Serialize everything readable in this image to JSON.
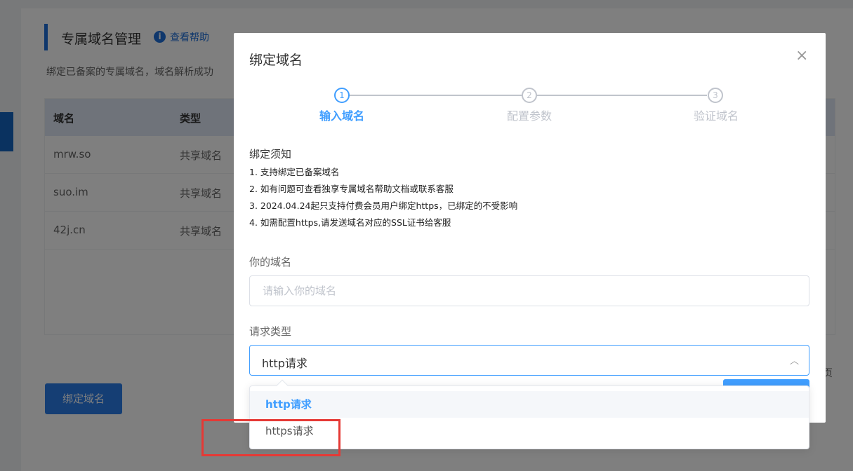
{
  "background": {
    "page_title": "专属域名管理",
    "help_link": "查看帮助",
    "description": "绑定已备案的专属域名，域名解析成功",
    "table": {
      "headers": [
        "域名",
        "类型"
      ],
      "rows": [
        {
          "domain": "mrw.so",
          "type": "共享域名"
        },
        {
          "domain": "suo.im",
          "type": "共享域名"
        },
        {
          "domain": "42j.cn",
          "type": "共享域名"
        }
      ]
    },
    "bind_button": "绑定域名",
    "pagination_char": "页"
  },
  "dialog": {
    "title": "绑定域名",
    "close": "×",
    "steps": [
      {
        "num": "1",
        "label": "输入域名",
        "active": true
      },
      {
        "num": "2",
        "label": "配置参数",
        "active": false
      },
      {
        "num": "3",
        "label": "验证域名",
        "active": false
      }
    ],
    "notice_title": "绑定须知",
    "notices": [
      "1. 支持绑定已备案域名",
      "2. 如有问题可查看独享专属域名帮助文档或联系客服",
      "3. 2024.04.24起只支持付费会员用户绑定https，已绑定的不受影响",
      "4. 如需配置https,请发送域名对应的SSL证书给客服"
    ],
    "domain_label": "你的域名",
    "domain_placeholder": "请输入你的域名",
    "domain_value": "",
    "request_label": "请求类型",
    "request_value": "http请求"
  },
  "dropdown": {
    "options": [
      "http请求",
      "https请求"
    ],
    "selected": "http请求"
  },
  "colors": {
    "primary": "#409eff",
    "highlight": "#e53935"
  }
}
